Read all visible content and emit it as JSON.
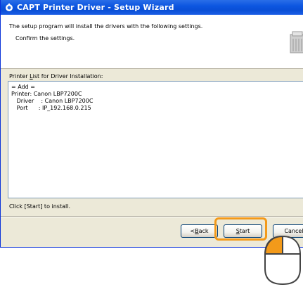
{
  "window": {
    "title": "CAPT Printer Driver - Setup Wizard"
  },
  "header": {
    "line1": "The setup program will install the drivers with the following settings.",
    "line2": "Confirm the settings."
  },
  "list": {
    "label_pre": "Printer ",
    "label_accel": "L",
    "label_post": "ist for Driver Installation:",
    "rows": [
      "= Add =",
      "Printer: Canon LBP7200C",
      "   Driver    : Canon LBP7200C",
      "   Port      : IP_192.168.0.215"
    ]
  },
  "hint": "Click [Start] to install.",
  "buttons": {
    "back_pre": "< ",
    "back_accel": "B",
    "back_post": "ack",
    "start_accel": "S",
    "start_post": "tart",
    "cancel": "Cancel"
  },
  "colors": {
    "titlebar": "#0a4fd6",
    "highlight": "#f39a1a",
    "mouse_button": "#f39a1a"
  },
  "icons": {
    "app": "printer-setup-icon",
    "header": "printer-graphic-icon",
    "pointer": "mouse-icon"
  }
}
